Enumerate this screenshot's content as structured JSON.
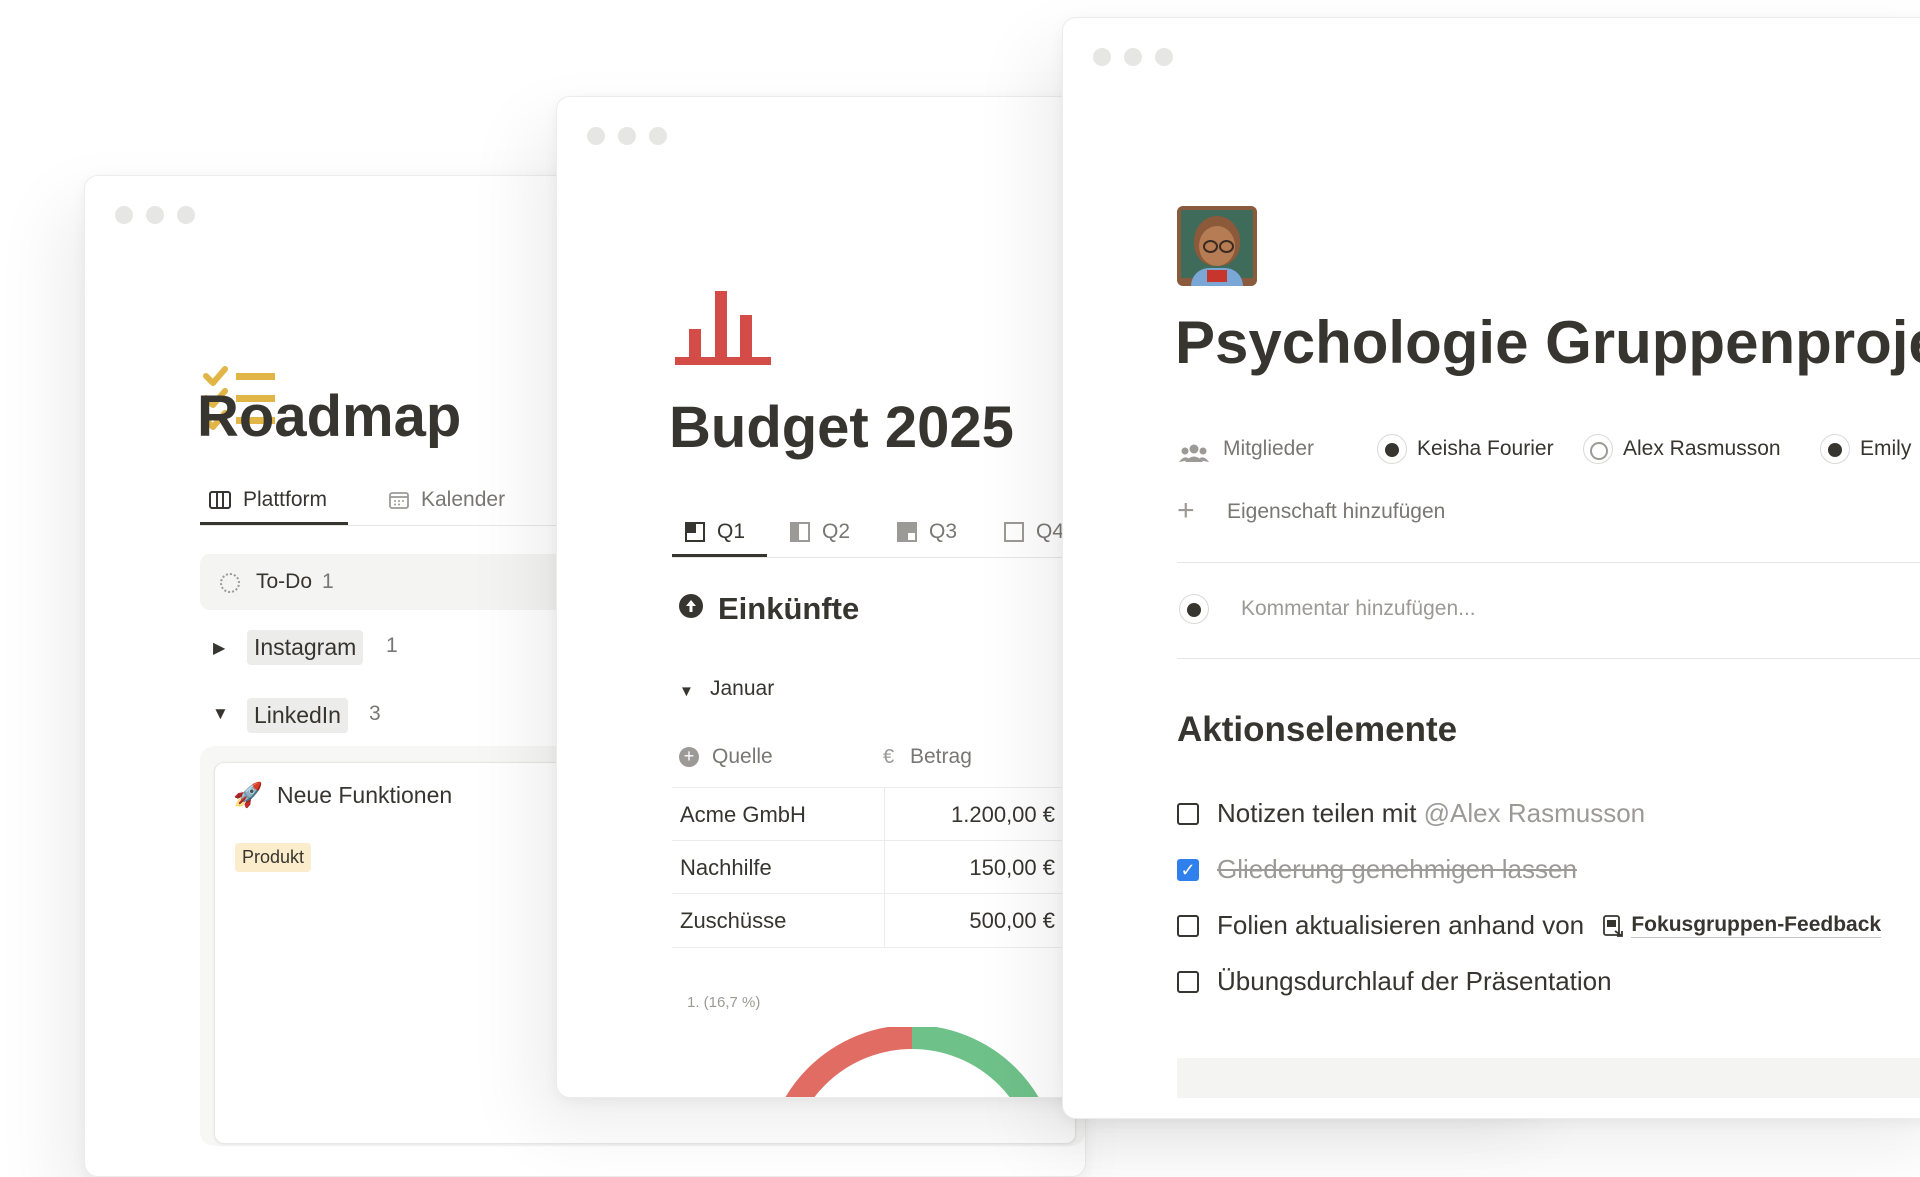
{
  "roadmap": {
    "title": "Roadmap",
    "icon": "checklist-icon",
    "tabs": [
      {
        "label": "Plattform",
        "icon": "board-icon",
        "active": true
      },
      {
        "label": "Kalender",
        "icon": "calendar-icon",
        "active": false
      }
    ],
    "status_group": {
      "label": "To-Do",
      "count": "1"
    },
    "groups": [
      {
        "label": "Instagram",
        "count": "1",
        "expanded": false
      },
      {
        "label": "LinkedIn",
        "count": "3",
        "expanded": true
      }
    ],
    "card": {
      "emoji": "🚀",
      "title": "Neue Funktionen",
      "tag": "Produkt"
    }
  },
  "budget": {
    "title": "Budget 2025",
    "icon": "bar-chart-icon",
    "icon_color": "#d44c47",
    "tabs": [
      {
        "label": "Q1",
        "active": true
      },
      {
        "label": "Q2",
        "active": false
      },
      {
        "label": "Q3",
        "active": false
      },
      {
        "label": "Q4",
        "active": false
      }
    ],
    "section_title": "Einkünfte",
    "group_label": "Januar",
    "columns": [
      {
        "label": "Quelle",
        "icon": "plus-circle-icon"
      },
      {
        "label": "Betrag",
        "icon": "euro-icon",
        "icon_text": "€"
      }
    ],
    "rows": [
      {
        "source": "Acme GmbH",
        "amount": "1.200,00 €"
      },
      {
        "source": "Nachhilfe",
        "amount": "150,00 €"
      },
      {
        "source": "Zuschüsse",
        "amount": "500,00 €"
      }
    ],
    "chart_label": "1. (16,7 %)",
    "chart_colors": [
      "#e06c63",
      "#6fc18a"
    ]
  },
  "project": {
    "emoji": "👩🏾‍🏫",
    "title": "Psychologie Gruppenprojekt",
    "members_label": "Mitglieder",
    "members": [
      {
        "name": "Keisha Fourier"
      },
      {
        "name": "Alex Rasmusson"
      },
      {
        "name": "Emily"
      }
    ],
    "add_property": "Eigenschaft hinzufügen",
    "comment_placeholder": "Kommentar hinzufügen...",
    "section": "Aktionselemente",
    "todos": [
      {
        "text": "Notizen teilen mit ",
        "mention": "@Alex Rasmusson",
        "checked": false
      },
      {
        "text": "Gliederung genehmigen lassen",
        "checked": true
      },
      {
        "text": "Folien aktualisieren anhand von ",
        "link": "Fokusgruppen-Feedback",
        "checked": false
      },
      {
        "text": "Übungsdurchlauf der Präsentation",
        "checked": false
      }
    ]
  }
}
